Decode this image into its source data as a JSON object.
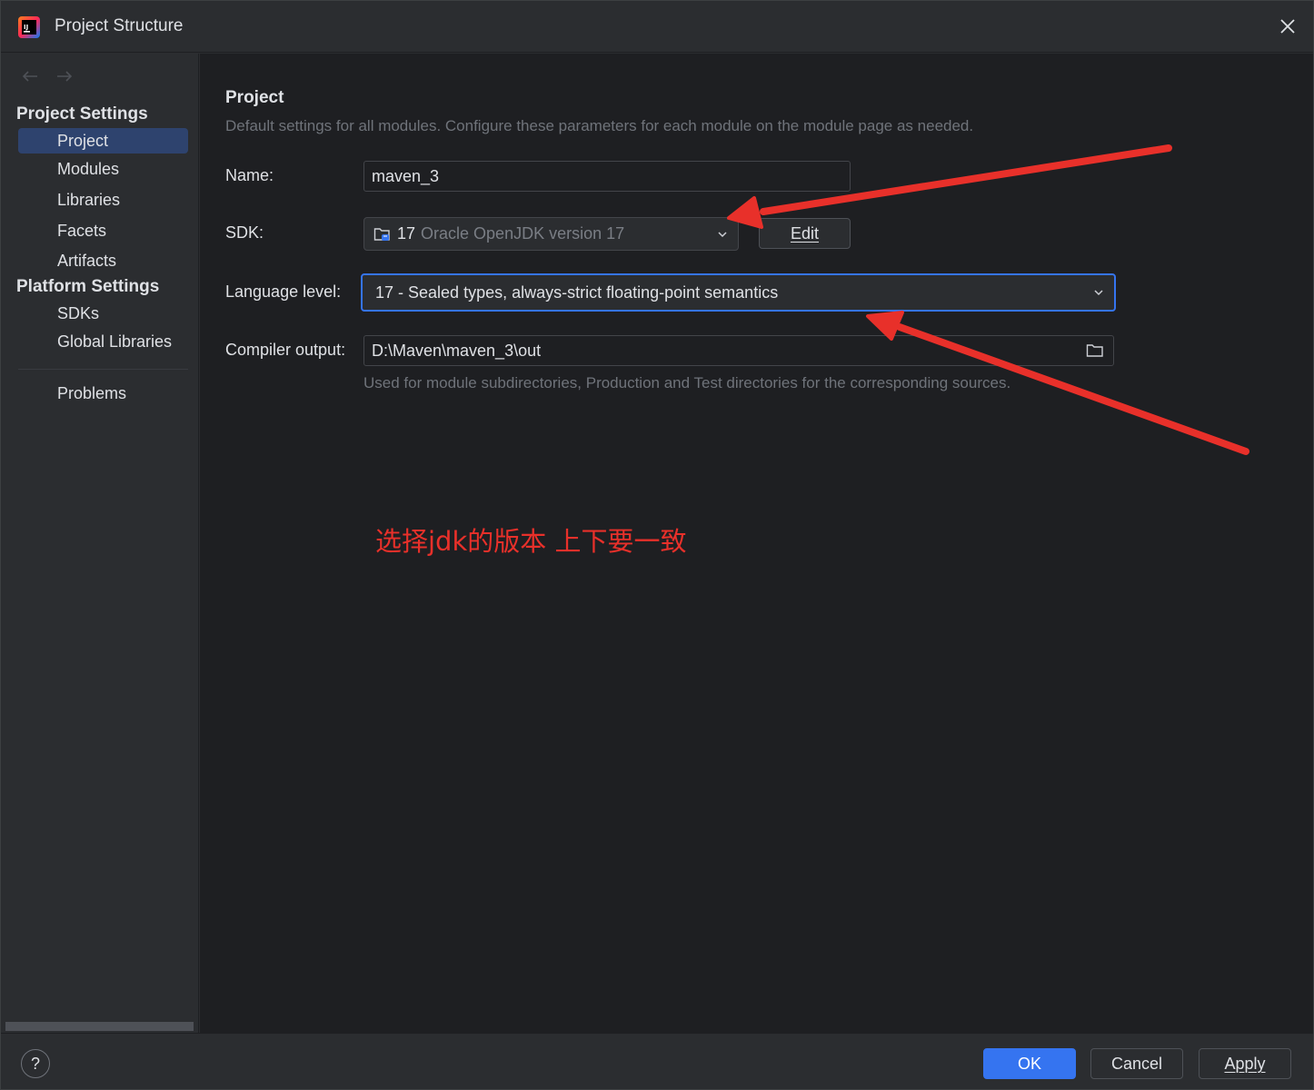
{
  "window": {
    "title": "Project Structure",
    "app_icon": "intellij-idea-icon"
  },
  "sidebar": {
    "groups": [
      {
        "title": "Project Settings"
      },
      {
        "title": "Platform Settings"
      }
    ],
    "items": [
      {
        "label": "Project",
        "selected": true
      },
      {
        "label": "Modules"
      },
      {
        "label": "Libraries"
      },
      {
        "label": "Facets"
      },
      {
        "label": "Artifacts"
      },
      {
        "label": "SDKs"
      },
      {
        "label": "Global Libraries"
      },
      {
        "label": "Problems"
      }
    ]
  },
  "panel": {
    "title": "Project",
    "description": "Default settings for all modules. Configure these parameters for each module on the module page as needed.",
    "name_label": "Name:",
    "name_value": "maven_3",
    "sdk_label": "SDK:",
    "sdk_version": "17",
    "sdk_name": "Oracle OpenJDK version 17",
    "edit_button": "Edit",
    "language_level_label": "Language level:",
    "language_level_value": "17 - Sealed types, always-strict floating-point semantics",
    "compiler_output_label": "Compiler output:",
    "compiler_output_value": "D:\\Maven\\maven_3\\out",
    "compiler_output_hint": "Used for module subdirectories, Production and Test directories for the corresponding sources."
  },
  "annotation": {
    "text": "选择jdk的版本  上下要一致",
    "color": "#e8302a"
  },
  "footer": {
    "help": "?",
    "ok": "OK",
    "cancel": "Cancel",
    "apply": "Apply"
  },
  "colors": {
    "accent": "#3574f0",
    "selection": "#2e436e",
    "arrow": "#e8302a"
  }
}
